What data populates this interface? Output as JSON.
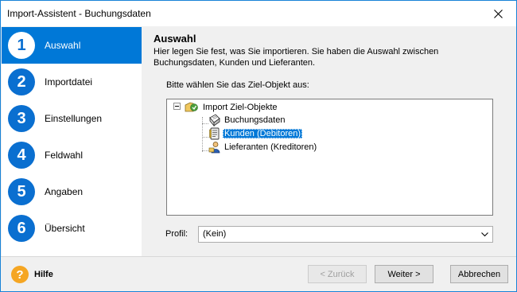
{
  "window": {
    "title": "Import-Assistent - Buchungsdaten"
  },
  "steps": [
    {
      "number": "1",
      "label": "Auswahl",
      "active": true
    },
    {
      "number": "2",
      "label": "Importdatei",
      "active": false
    },
    {
      "number": "3",
      "label": "Einstellungen",
      "active": false
    },
    {
      "number": "4",
      "label": "Feldwahl",
      "active": false
    },
    {
      "number": "5",
      "label": "Angaben",
      "active": false
    },
    {
      "number": "6",
      "label": "Übersicht",
      "active": false
    }
  ],
  "page": {
    "heading": "Auswahl",
    "description": "Hier legen Sie fest, was Sie importieren. Sie haben die Auswahl zwischen Buchungsdaten, Kunden und Lieferanten.",
    "prompt": "Bitte wählen Sie das Ziel-Objekt aus:"
  },
  "tree": {
    "root": {
      "label": "Import Ziel-Objekte",
      "expanded": true,
      "icon": "import-folder-icon"
    },
    "children": [
      {
        "label": "Buchungsdaten",
        "icon": "ledger-book-icon",
        "selected": false
      },
      {
        "label": "Kunden (Debitoren)",
        "icon": "customer-card-icon",
        "selected": true
      },
      {
        "label": "Lieferanten (Kreditoren)",
        "icon": "supplier-person-icon",
        "selected": false
      }
    ]
  },
  "profil": {
    "label": "Profil:",
    "value": "(Kein)"
  },
  "footer": {
    "help_label": "Hilfe",
    "back_label": "< Zurück",
    "next_label": "Weiter >",
    "cancel_label": "Abbrechen"
  },
  "colors": {
    "accent": "#0078d7",
    "step_circle": "#0a6fd0",
    "help": "#f5a623"
  }
}
